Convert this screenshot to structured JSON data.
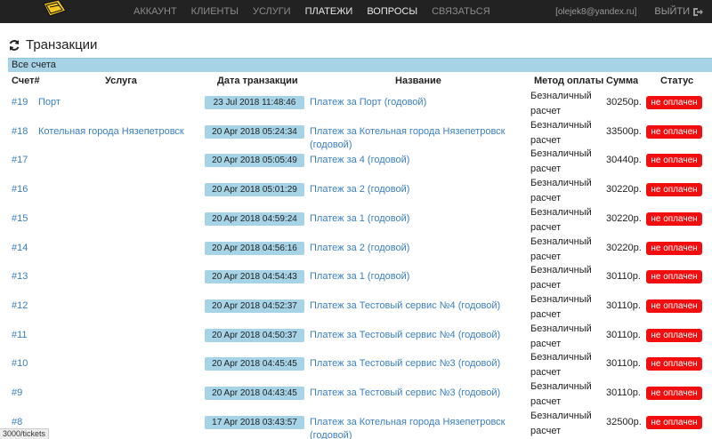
{
  "nav": {
    "links": [
      "АККАУНТ",
      "КЛИЕНТЫ",
      "УСЛУГИ",
      "ПЛАТЕЖИ",
      "ВОПРОСЫ",
      "СВЯЗАТЬСЯ"
    ],
    "active": [
      false,
      false,
      false,
      true,
      true,
      false
    ],
    "user_email": "[olejek8@yandex.ru]",
    "logout_label": "ВЫЙТИ"
  },
  "page": {
    "title": "Транзакции",
    "panel_title": "Все счета"
  },
  "table": {
    "headers": {
      "invoice": "Счет#",
      "service": "Услуга",
      "date": "Дата транзакции",
      "name": "Название",
      "method": "Метод оплаты",
      "sum": "Сумма",
      "status": "Статус"
    },
    "rows": [
      {
        "invoice": "#19",
        "service": "Порт",
        "date": "23 Jul 2018 11:48:46",
        "name": "Платеж за Порт (годовой)",
        "method": "Безналичный расчет",
        "sum": "30250р.",
        "status": "не оплачен"
      },
      {
        "invoice": "#18",
        "service": "Котельная города Нязепетровск",
        "date": "20 Apr 2018 05:24:34",
        "name": "Платеж за Котельная города Нязепетровск (годовой)",
        "method": "Безналичный расчет",
        "sum": "33500р.",
        "status": "не оплачен"
      },
      {
        "invoice": "#17",
        "service": "",
        "date": "20 Apr 2018 05:05:49",
        "name": "Платеж за 4 (годовой)",
        "method": "Безналичный расчет",
        "sum": "30440р.",
        "status": "не оплачен"
      },
      {
        "invoice": "#16",
        "service": "",
        "date": "20 Apr 2018 05:01:29",
        "name": "Платеж за 2 (годовой)",
        "method": "Безналичный расчет",
        "sum": "30220р.",
        "status": "не оплачен"
      },
      {
        "invoice": "#15",
        "service": "",
        "date": "20 Apr 2018 04:59:24",
        "name": "Платеж за 1 (годовой)",
        "method": "Безналичный расчет",
        "sum": "30220р.",
        "status": "не оплачен"
      },
      {
        "invoice": "#14",
        "service": "",
        "date": "20 Apr 2018 04:56:16",
        "name": "Платеж за 2 (годовой)",
        "method": "Безналичный расчет",
        "sum": "30220р.",
        "status": "не оплачен"
      },
      {
        "invoice": "#13",
        "service": "",
        "date": "20 Apr 2018 04:54:43",
        "name": "Платеж за 1 (годовой)",
        "method": "Безналичный расчет",
        "sum": "30110р.",
        "status": "не оплачен"
      },
      {
        "invoice": "#12",
        "service": "",
        "date": "20 Apr 2018 04:52:37",
        "name": "Платеж за Тестовый сервис №4 (годовой)",
        "method": "Безналичный расчет",
        "sum": "30110р.",
        "status": "не оплачен"
      },
      {
        "invoice": "#11",
        "service": "",
        "date": "20 Apr 2018 04:50:37",
        "name": "Платеж за Тестовый сервис №4 (годовой)",
        "method": "Безналичный расчет",
        "sum": "30110р.",
        "status": "не оплачен"
      },
      {
        "invoice": "#10",
        "service": "",
        "date": "20 Apr 2018 04:45:45",
        "name": "Платеж за Тестовый сервис №3 (годовой)",
        "method": "Безналичный расчет",
        "sum": "30110р.",
        "status": "не оплачен"
      },
      {
        "invoice": "#9",
        "service": "",
        "date": "20 Apr 2018 04:43:45",
        "name": "Платеж за Тестовый сервис №3 (годовой)",
        "method": "Безналичный расчет",
        "sum": "30110р.",
        "status": "не оплачен"
      },
      {
        "invoice": "#8",
        "service": "",
        "date": "17 Apr 2018 03:43:57",
        "name": "Платеж за Котельная города Нязепетровск (годовой)",
        "method": "Безналичный расчет",
        "sum": "32500р.",
        "status": "не оплачен"
      }
    ]
  },
  "statusbar_url": "3000/tickets",
  "colors": {
    "navbar": "#222222",
    "accent": "#a7d3e7",
    "link": "#3a7ec0",
    "status_unpaid": "#f20e0e"
  }
}
